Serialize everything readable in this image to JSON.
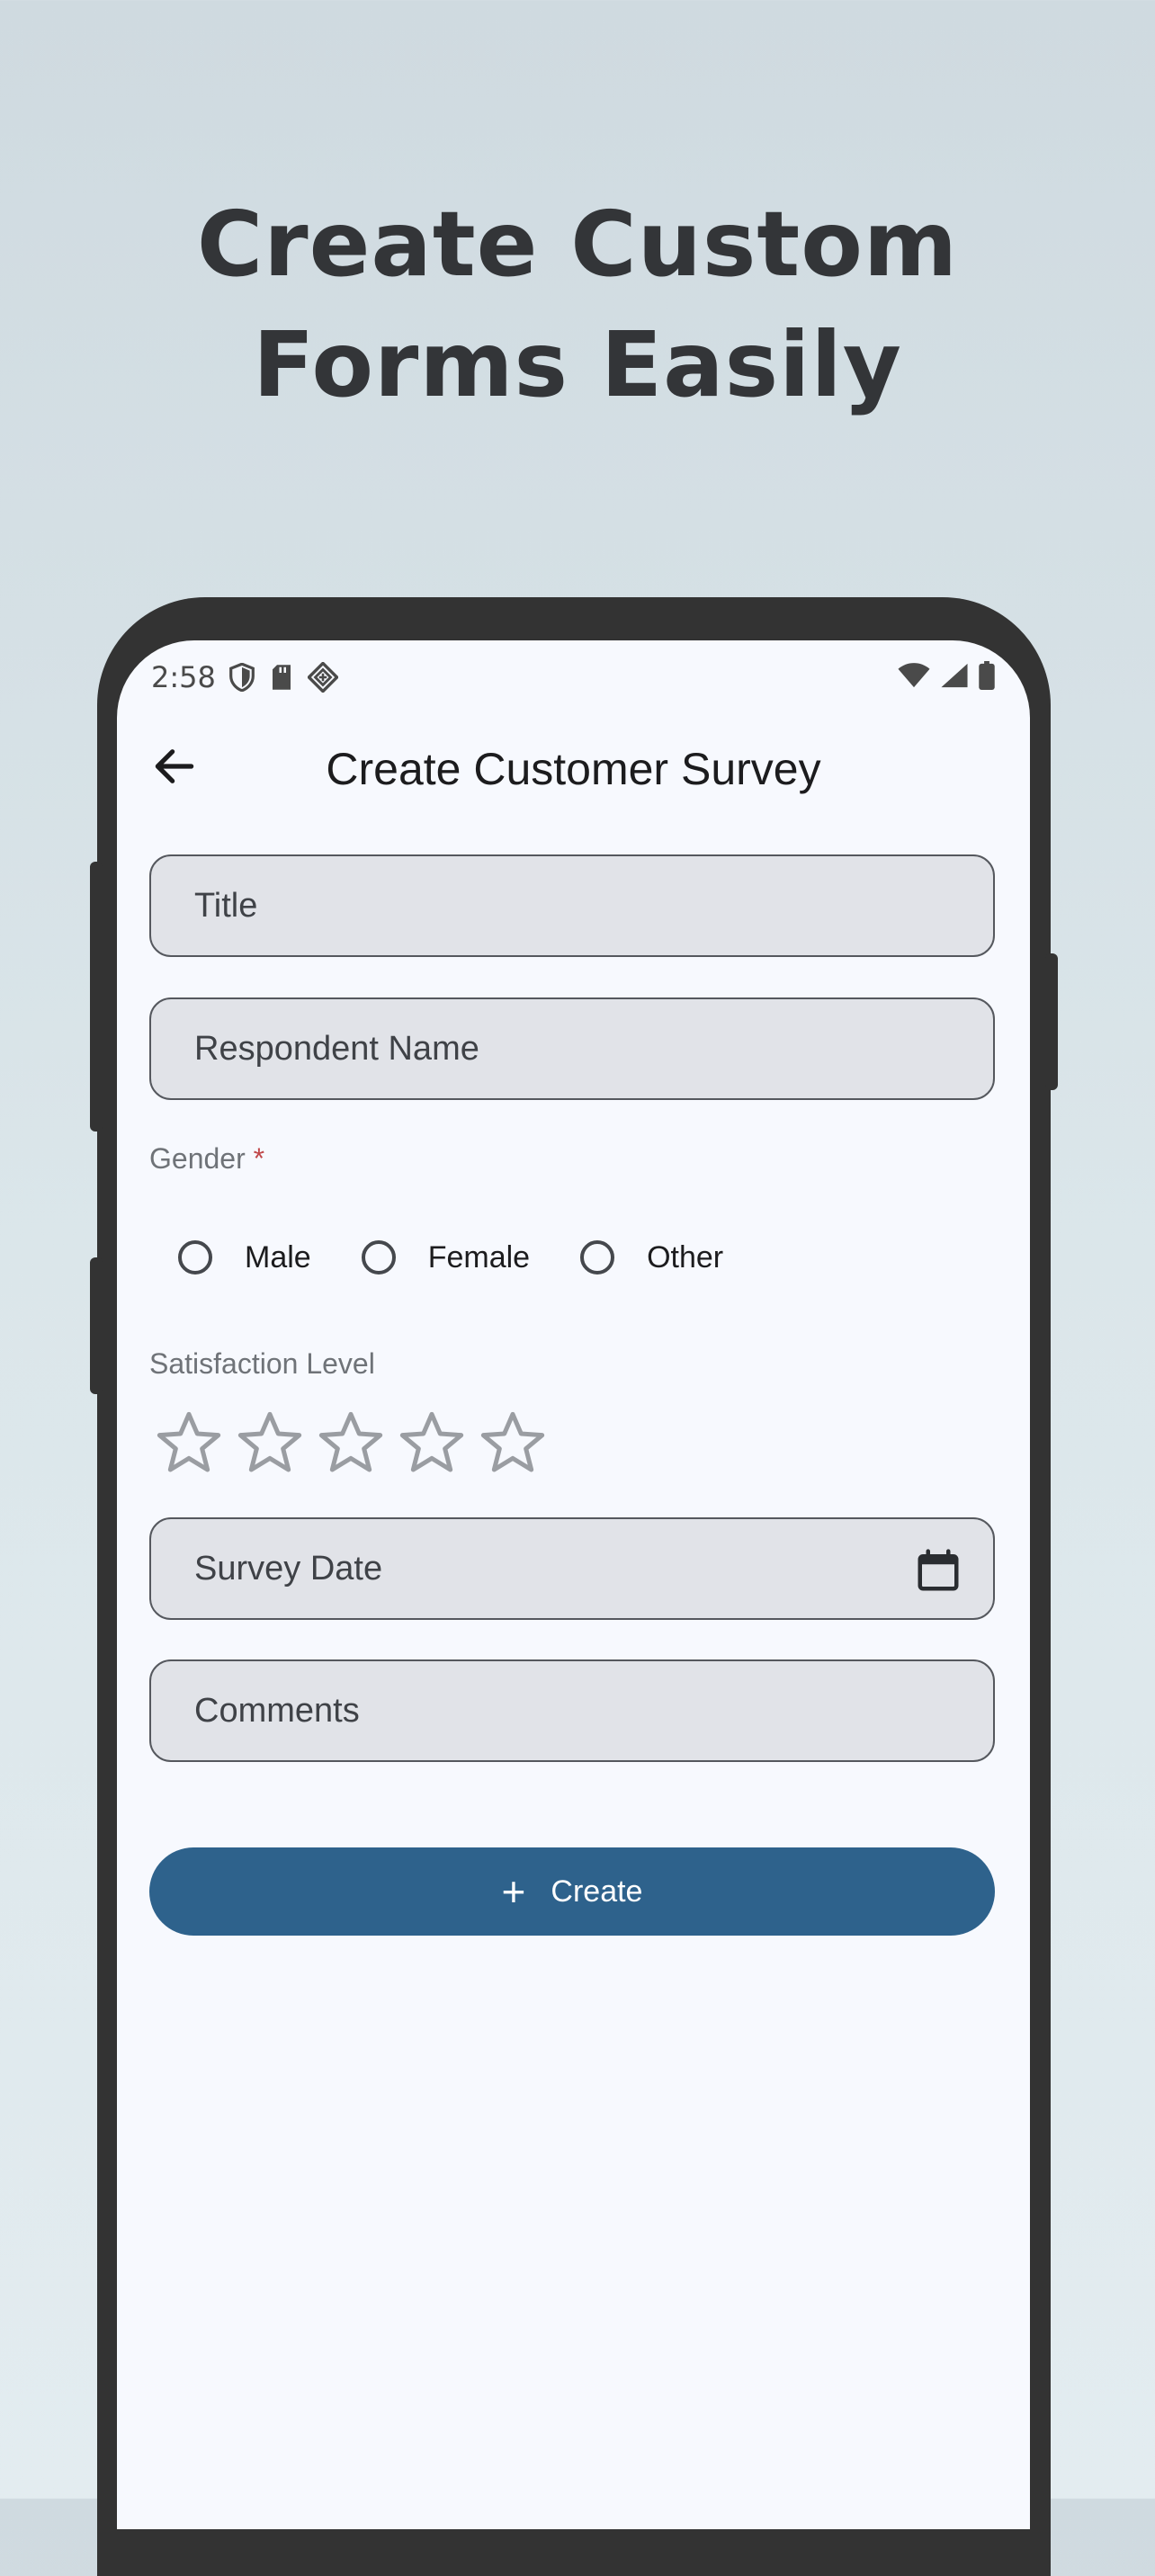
{
  "headline": {
    "line1": "Create Custom",
    "line2": "Forms Easily"
  },
  "status_bar": {
    "time": "2:58"
  },
  "app_bar": {
    "title": "Create Customer Survey"
  },
  "form": {
    "title_label": "Title",
    "respondent_label": "Respondent Name",
    "gender_label": "Gender",
    "gender_required_mark": "*",
    "gender_options": [
      "Male",
      "Female",
      "Other"
    ],
    "satisfaction_label": "Satisfaction Level",
    "satisfaction_rating": 0,
    "satisfaction_max": 5,
    "date_label": "Survey Date",
    "comments_label": "Comments",
    "create_label": "Create"
  },
  "colors": {
    "primary": "#2e628c",
    "field_bg": "#e1e3e8",
    "required": "#c0484a",
    "screen_bg": "#f7f9fe"
  }
}
